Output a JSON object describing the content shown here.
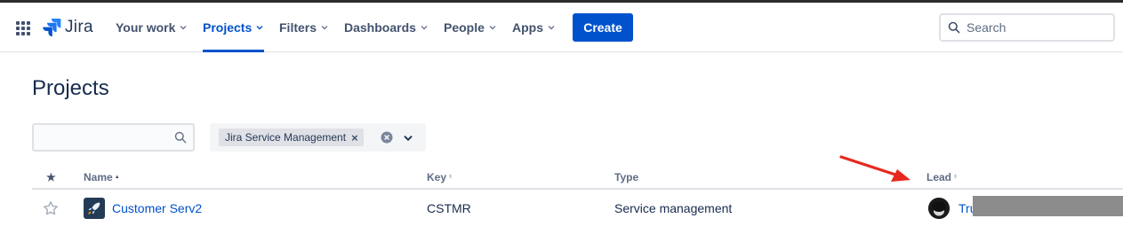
{
  "topnav": {
    "logo_text": "Jira",
    "items": [
      {
        "label": "Your work"
      },
      {
        "label": "Projects"
      },
      {
        "label": "Filters"
      },
      {
        "label": "Dashboards"
      },
      {
        "label": "People"
      },
      {
        "label": "Apps"
      }
    ],
    "active_item": "Projects",
    "create_label": "Create",
    "search_placeholder": "Search"
  },
  "page": {
    "title": "Projects"
  },
  "filters": {
    "search_value": "",
    "product_tag": "Jira Service Management",
    "tag_remove_glyph": "×"
  },
  "table": {
    "headers": {
      "star": "★",
      "name": "Name",
      "key": "Key",
      "type": "Type",
      "lead": "Lead"
    },
    "sorted_by": "Name",
    "rows": [
      {
        "name": "Customer Serv2",
        "key": "CSTMR",
        "type": "Service management",
        "lead": "Tru",
        "starred": false
      }
    ]
  },
  "colors": {
    "brand_blue": "#0052CC",
    "text_primary": "#172B4D",
    "text_subtle": "#5E6C84",
    "annotation_arrow": "#E8281E",
    "redaction": "#8C8C8C"
  }
}
